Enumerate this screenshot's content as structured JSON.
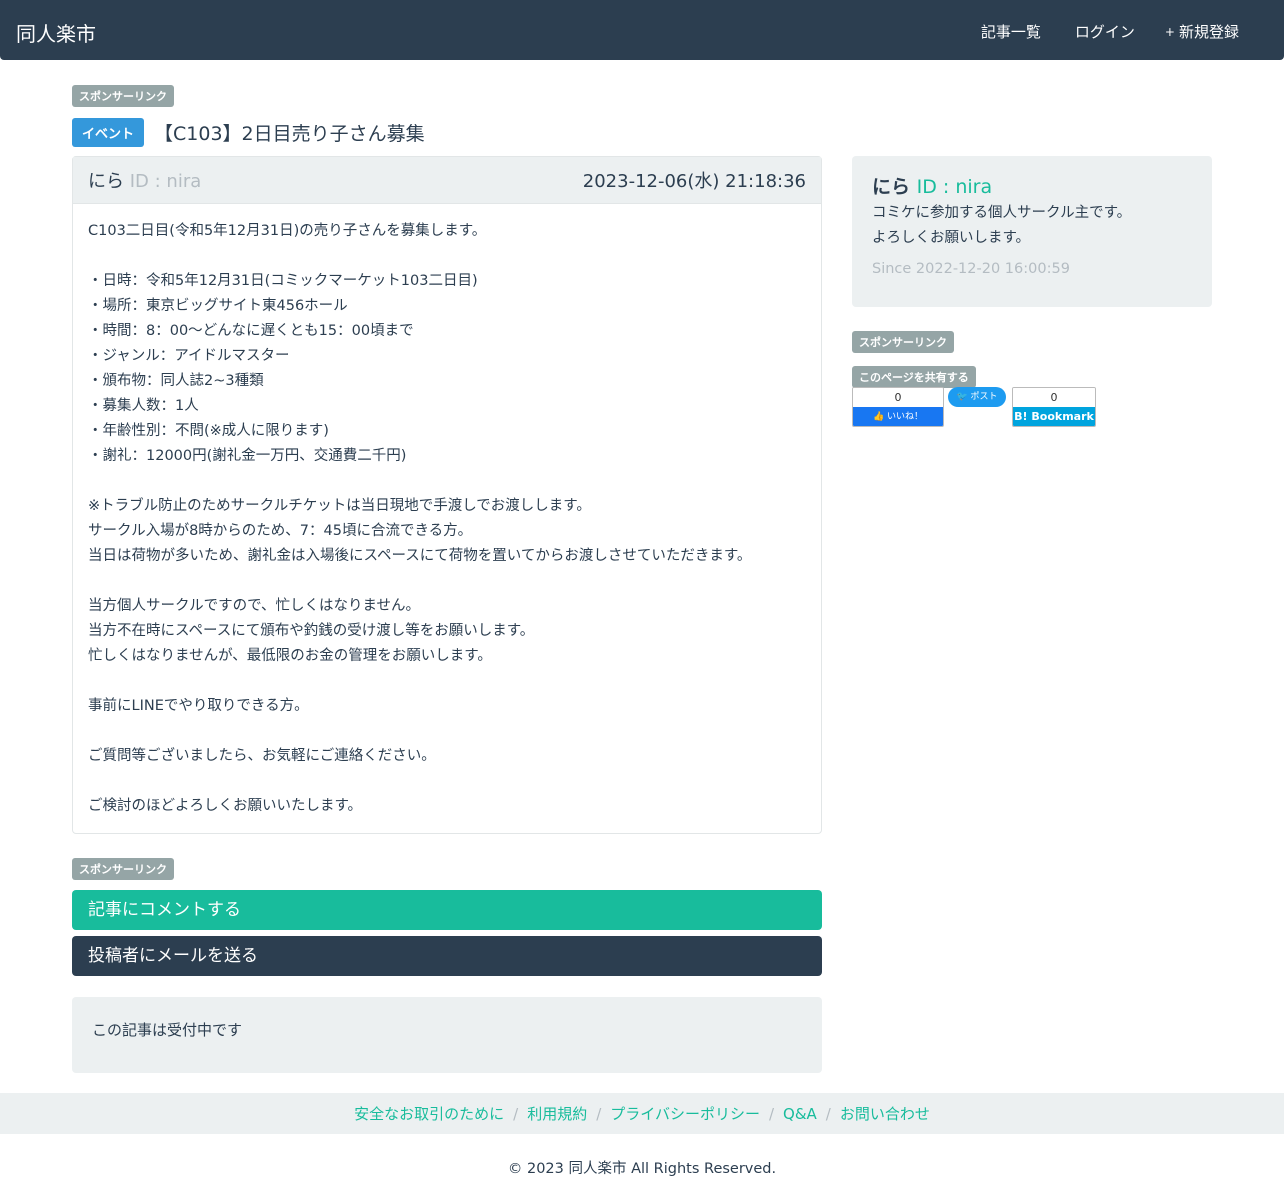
{
  "nav": {
    "brand": "同人楽市",
    "links": [
      {
        "icon": "list-icon",
        "glyph": "",
        "label": "記事一覧"
      },
      {
        "icon": "login-icon",
        "glyph": "",
        "label": "ログイン"
      },
      {
        "icon": "plus-icon",
        "glyph": "+",
        "label": "新規登録"
      }
    ]
  },
  "sponsor_label": "スポンサーリンク",
  "post": {
    "category": "イベント",
    "title": "【C103】2日目売り子さん募集",
    "author_name": "にら",
    "author_id": "ID : nira",
    "datetime": "2023-12-06(水) 21:18:36",
    "body": [
      "C103二日目(令和5年12月31日)の売り子さんを募集します。",
      "",
      "・日時：令和5年12月31日(コミックマーケット103二日目)",
      "・場所：東京ビッグサイト東456ホール",
      "・時間：8：00〜どんなに遅くとも15：00頃まで",
      "・ジャンル：アイドルマスター",
      "・頒布物：同人誌2~3種類",
      "・募集人数：1人",
      "・年齢性別：不問(※成人に限ります)",
      "・謝礼：12000円(謝礼金一万円、交通費二千円)",
      "",
      "※トラブル防止のためサークルチケットは当日現地で手渡しでお渡しします。",
      "サークル入場が8時からのため、7：45頃に合流できる方。",
      "当日は荷物が多いため、謝礼金は入場後にスペースにて荷物を置いてからお渡しさせていただきます。",
      "",
      "当方個人サークルですので、忙しくはなりません。",
      "当方不在時にスペースにて頒布や釣銭の受け渡し等をお願いします。",
      "忙しくはなりませんが、最低限のお金の管理をお願いします。",
      "",
      "事前にLINEでやり取りできる方。",
      "",
      "ご質問等ございましたら、お気軽にご連絡ください。",
      "",
      "ご検討のほどよろしくお願いいたします。"
    ]
  },
  "profile": {
    "name": "にら",
    "id": "ID : nira",
    "bio": [
      "コミケに参加する個人サークル主です。",
      "よろしくお願いします。"
    ],
    "since": "Since 2022-12-20 16:00:59"
  },
  "share": {
    "label": "このページを共有する",
    "facebook_count": "0",
    "facebook_label": "いいね！",
    "twitter_label": "ポスト",
    "hatena_count": "0",
    "hatena_label": "B! Bookmark"
  },
  "actions": {
    "comment": "記事にコメントする",
    "mail": "投稿者にメールを送る"
  },
  "status": "この記事は受付中です",
  "footer": {
    "links": [
      "安全なお取引のために",
      "利用規約",
      "プライバシーポリシー",
      "Q&A",
      "お問い合わせ"
    ],
    "copyright": "© 2023 同人楽市 All Rights Reserved."
  },
  "colors": {
    "navbar": "#2c3e50",
    "accent": "#18bc9c",
    "category": "#3498db",
    "badge": "#95a5a6"
  }
}
